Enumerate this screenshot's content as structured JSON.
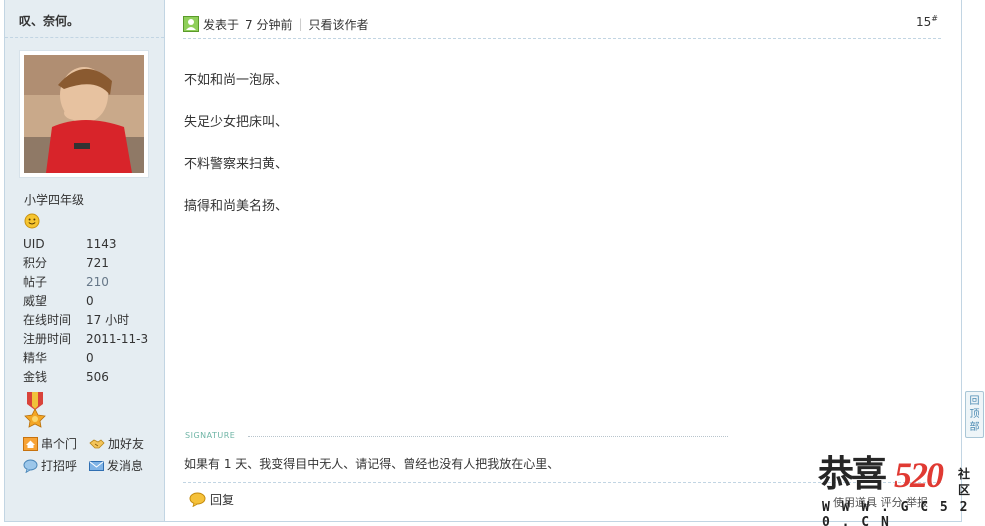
{
  "author": {
    "name": "叹、奈何。",
    "group": "小学四年级",
    "stats": [
      {
        "key": "UID",
        "value": "1143"
      },
      {
        "key": "积分",
        "value": "721"
      },
      {
        "key": "帖子",
        "value": "210"
      },
      {
        "key": "威望",
        "value": "0"
      },
      {
        "key": "在线时间",
        "value": "17 小时"
      },
      {
        "key": "注册时间",
        "value": "2011-11-3"
      },
      {
        "key": "精华",
        "value": "0"
      },
      {
        "key": "金钱",
        "value": "506"
      }
    ],
    "actions": {
      "visit": "串个门",
      "add_friend": "加好友",
      "poke": "打招呼",
      "message": "发消息"
    }
  },
  "post": {
    "posted_prefix": "发表于",
    "posted_time": "7 分钟前",
    "only_author": "只看该作者",
    "floor": "15",
    "floor_mark": "#",
    "lines": [
      "不如和尚一泡尿、",
      "失足少女把床叫、",
      "不料警察来扫黄、",
      "搞得和尚美名扬、"
    ],
    "signature_label": "SIGNATURE",
    "signature": "如果有 1 天、我变得目中无人、请记得、曾经也没有人把我放在心里、",
    "reply": "回复",
    "footer_right": "使用道具    评分    举报"
  },
  "back_to_top": "回顶部",
  "watermark": {
    "brand": "恭喜",
    "number": "520",
    "side": "社区",
    "url": "W W W . G C 5 2 0 . C N"
  },
  "colors": {
    "sidebar_bg": "#e5edf2",
    "border": "#c2d5e3",
    "watermark_red": "#e03a33"
  }
}
